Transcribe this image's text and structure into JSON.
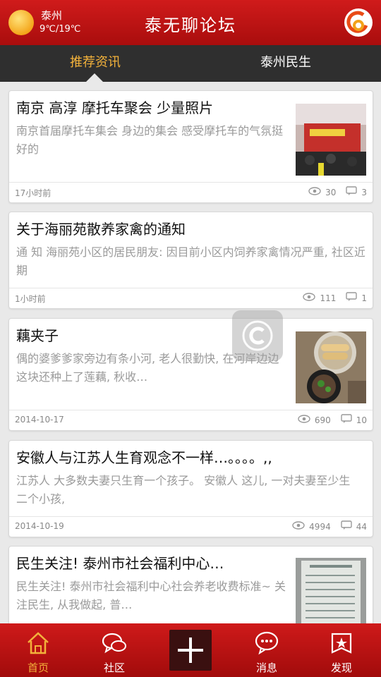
{
  "header": {
    "city": "泰州",
    "temperature": "9℃/19℃",
    "app_title": "泰无聊论坛",
    "weather_icon": "sun-icon",
    "logo_icon": "app-logo-icon"
  },
  "tabs": [
    {
      "label": "推荐资讯",
      "active": true
    },
    {
      "label": "泰州民生",
      "active": false
    }
  ],
  "feed": [
    {
      "title": "南京 高淳 摩托车聚会 少量照片",
      "summary": "南京首届摩托车集会 身边的集会 感受摩托车的气氛挺好的",
      "time": "17小时前",
      "views": "30",
      "comments": "3",
      "has_thumb": true
    },
    {
      "title": "关于海丽苑散养家禽的通知",
      "summary": "通 知  海丽苑小区的居民朋友: 因目前小区内饲养家禽情况严重, 社区近期",
      "time": "1小时前",
      "views": "111",
      "comments": "1",
      "has_thumb": false
    },
    {
      "title": "藕夹子",
      "summary": "偶的婆爹爹家旁边有条小河, 老人很勤快, 在河岸边边这块还种上了莲藕, 秋收…",
      "time": "2014-10-17",
      "views": "690",
      "comments": "10",
      "has_thumb": true
    },
    {
      "title": "安徽人与江苏人生育观念不一样…。。。。,,",
      "summary": "江苏人 大多数夫妻只生育一个孩子。 安徽人 这儿, 一对夫妻至少生二个小孩,",
      "time": "2014-10-19",
      "views": "4994",
      "comments": "44",
      "has_thumb": false
    },
    {
      "title": "民生关注! 泰州市社会福利中心…",
      "summary": "民生关注! 泰州市社会福利中心社会养老收费标准~ 关注民生, 从我做起, 普…",
      "time": "",
      "views": "",
      "comments": "",
      "has_thumb": true
    }
  ],
  "bottom_nav": [
    {
      "label": "首页",
      "icon": "home-icon",
      "active": true
    },
    {
      "label": "社区",
      "icon": "community-icon",
      "active": false
    },
    {
      "label": "",
      "icon": "plus-icon",
      "active": false
    },
    {
      "label": "消息",
      "icon": "message-icon",
      "active": false
    },
    {
      "label": "发现",
      "icon": "discover-icon",
      "active": false
    }
  ],
  "colors": {
    "brand_red": "#c41414",
    "active_tab": "#f3b23b",
    "tab_bar": "#2f2f2f"
  }
}
